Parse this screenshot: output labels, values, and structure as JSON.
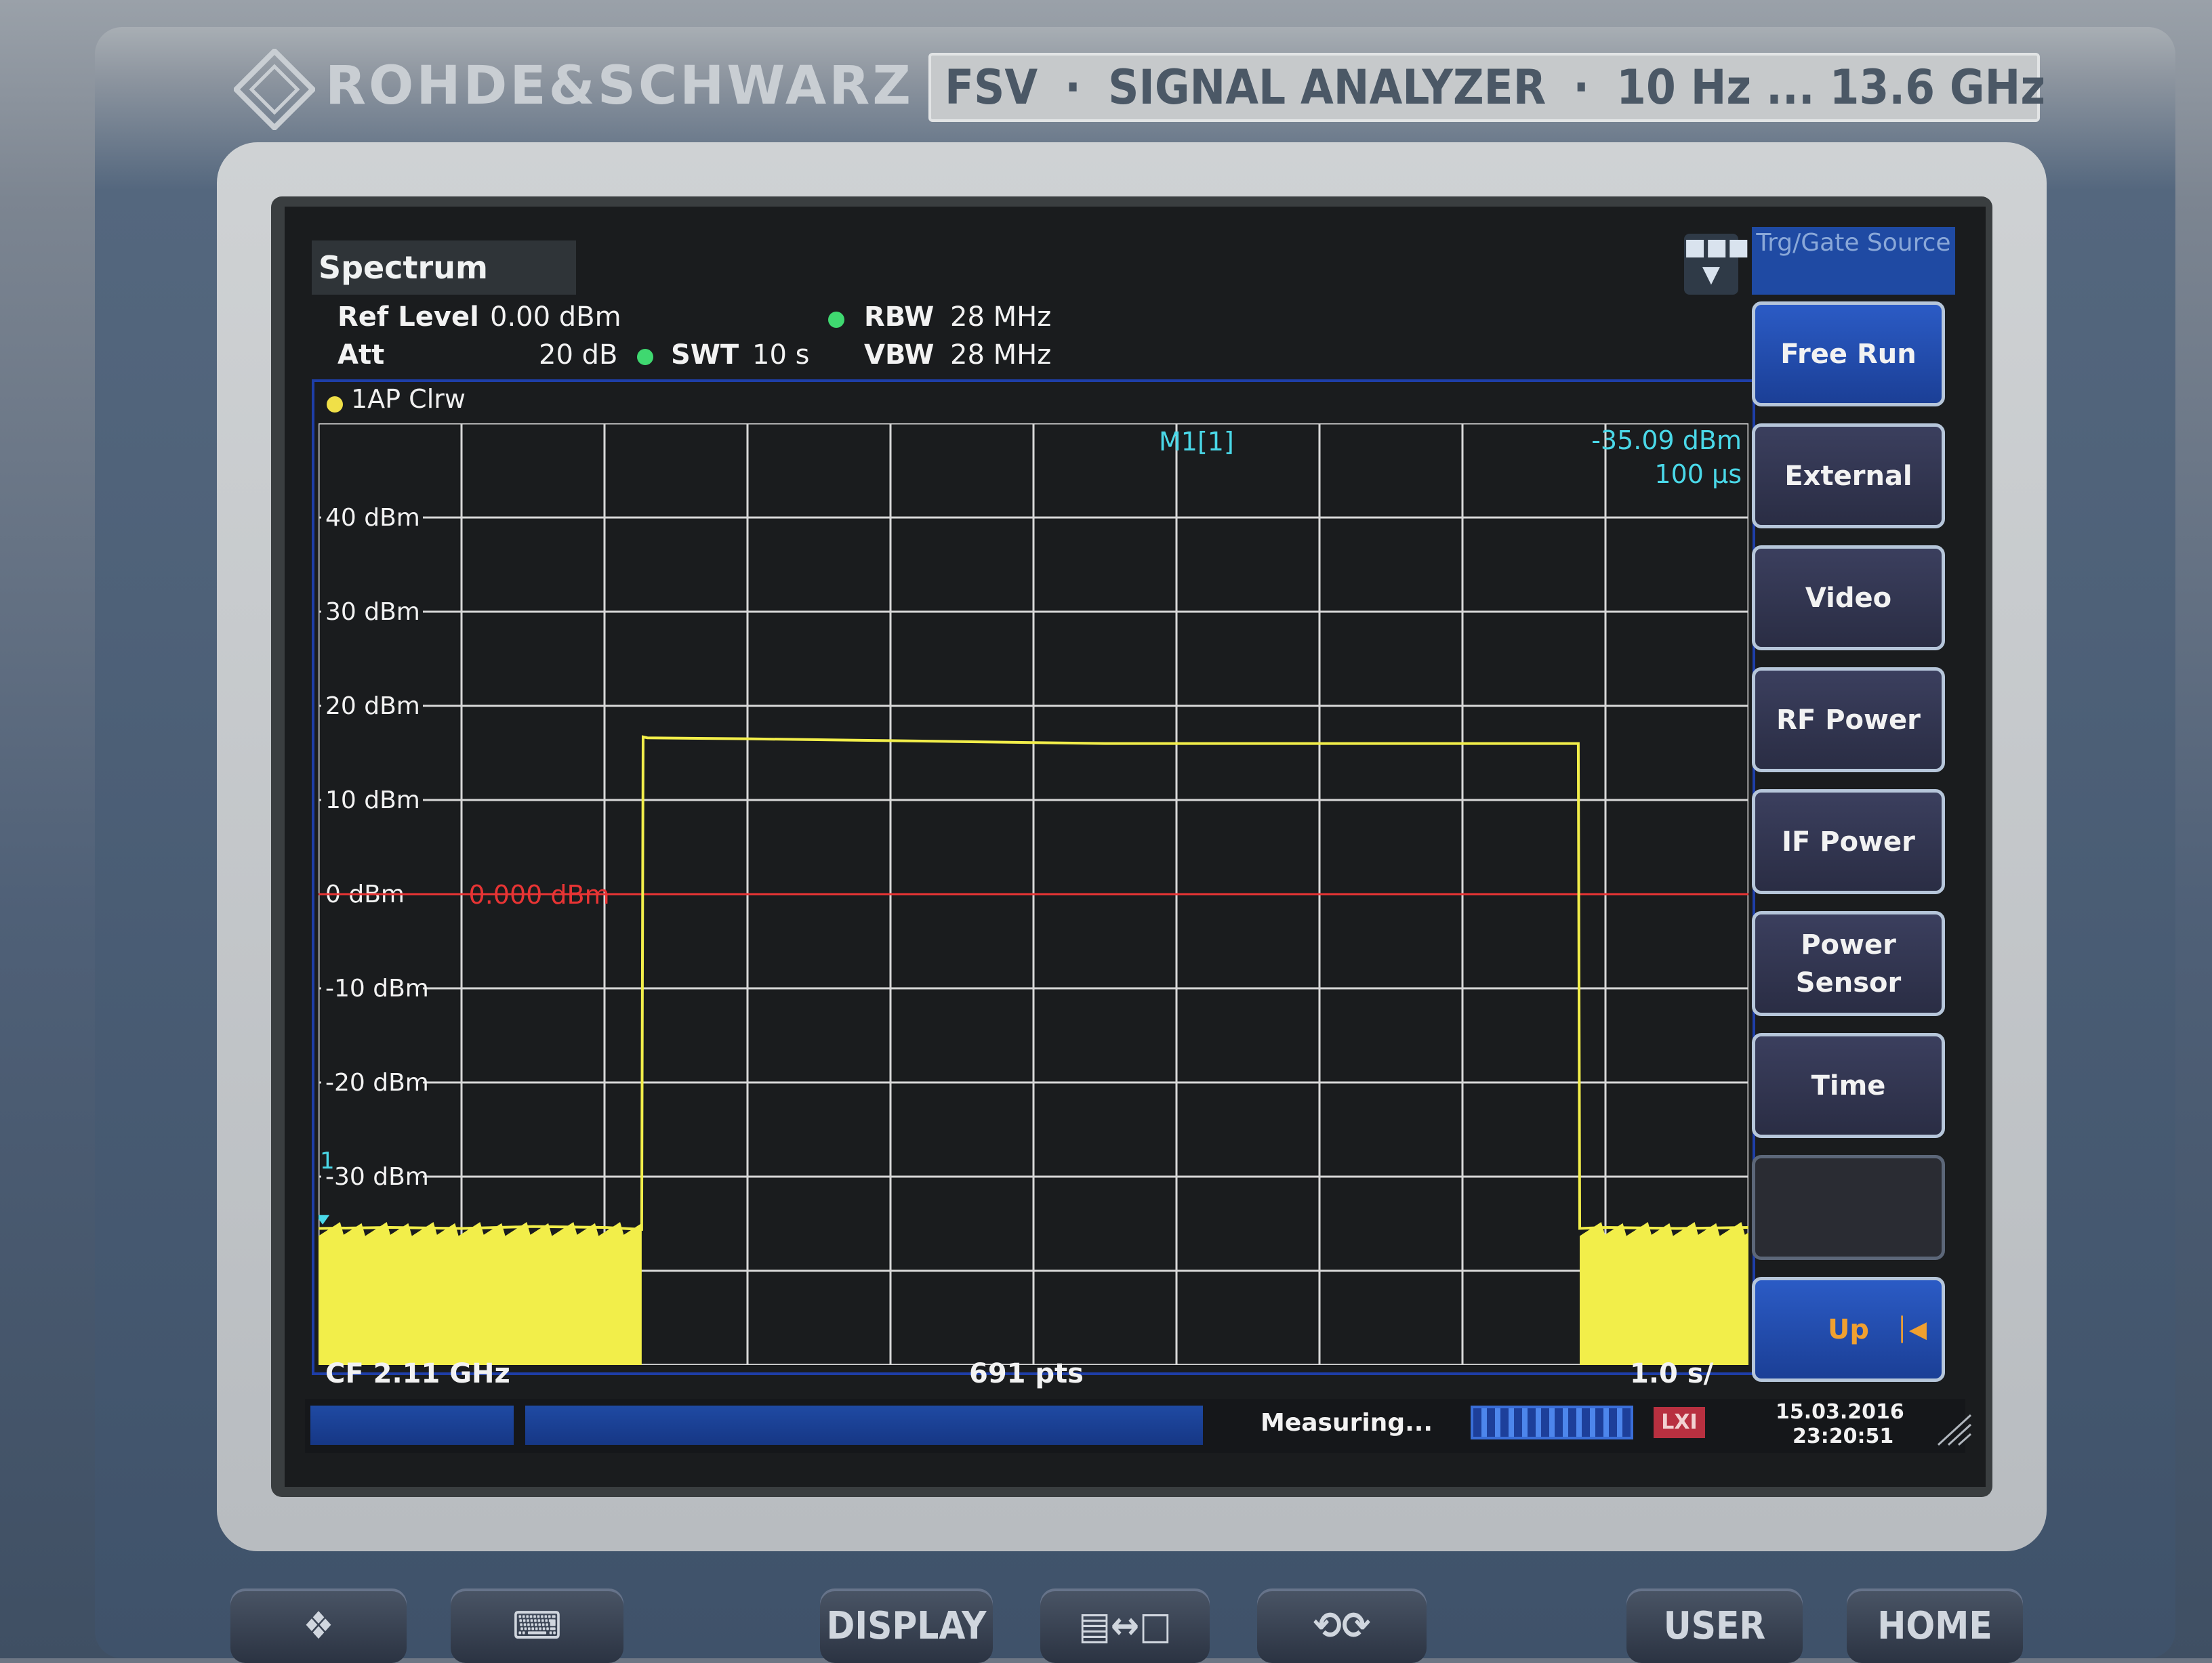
{
  "instrument": {
    "brand": "ROHDE&SCHWARZ",
    "model_plate": {
      "model": "FSV",
      "separator": "·",
      "type": "SIGNAL ANALYZER",
      "range": "10 Hz ... 13.6 GHz"
    }
  },
  "header": {
    "tab": "Spectrum",
    "ref_level_label": "Ref Level",
    "ref_level_value": "0.00 dBm",
    "att_label": "Att",
    "att_value": "20 dB",
    "swt_label": "SWT",
    "swt_value": "10 s",
    "rbw_label": "RBW",
    "rbw_value": "28 MHz",
    "vbw_label": "VBW",
    "vbw_value": "28 MHz"
  },
  "diagram": {
    "trace_label": "1AP Clrw",
    "marker_label": "M1[1]",
    "marker_level": "-35.09 dBm",
    "marker_time": "100 µs",
    "ref_line_label": "0.000 dBm",
    "marker_number": "1",
    "cf_label": "CF 2.11 GHz",
    "pts_label": "691 pts",
    "sweep_time_label": "1.0 s/"
  },
  "chart_data": {
    "type": "line",
    "y_unit": "dBm",
    "ylim": [
      -50,
      50
    ],
    "y_ticks": [
      {
        "value": 40,
        "label": "40 dBm"
      },
      {
        "value": 30,
        "label": "30 dBm"
      },
      {
        "value": 20,
        "label": "20 dBm"
      },
      {
        "value": 10,
        "label": "10 dBm"
      },
      {
        "value": 0,
        "label": "0 dBm"
      },
      {
        "value": -10,
        "label": "-10 dBm"
      },
      {
        "value": -20,
        "label": "-20 dBm"
      },
      {
        "value": -30,
        "label": "-30 dBm"
      }
    ],
    "xlim": [
      0,
      10
    ],
    "x_unit": "s",
    "grid": true,
    "ref_line_value": 0,
    "series": [
      {
        "color": "#f2ee4a",
        "x": [
          0,
          0.5,
          1.0,
          1.5,
          2.0,
          2.26,
          2.27,
          2.3,
          3.0,
          4.0,
          5.0,
          5.5,
          6.0,
          7.0,
          8.0,
          8.81,
          8.82,
          9.0,
          9.5,
          10
        ],
        "y": [
          -35.5,
          -35.4,
          -35.5,
          -35.3,
          -35.4,
          -35.6,
          16.7,
          16.6,
          16.5,
          16.3,
          16.1,
          16.0,
          16.0,
          16.0,
          16.0,
          16.0,
          -35.5,
          -35.4,
          -35.5,
          -35.4
        ],
        "fill_noise_from": -50
      }
    ],
    "marker": {
      "x": 0.01,
      "y": -35.09
    }
  },
  "softkeys": {
    "title": "Trg/Gate Source",
    "items": [
      "Free Run",
      "External",
      "Video",
      "RF Power",
      "IF Power",
      "Power Sensor",
      "Time",
      "",
      "Up"
    ]
  },
  "status_bar": {
    "text": "Measuring...",
    "date": "15.03.2016",
    "time": "23:20:51",
    "indicator": "LXI"
  },
  "front_panel": {
    "keys": [
      "DISPLAY",
      "USER",
      "HOME"
    ]
  },
  "colors": {
    "trace": "#f2ee4a",
    "ref_line": "#e83434",
    "grid": "#d8d8d8",
    "marker_text": "#4ad8e8",
    "softkey_active": "#1f4aa3"
  }
}
